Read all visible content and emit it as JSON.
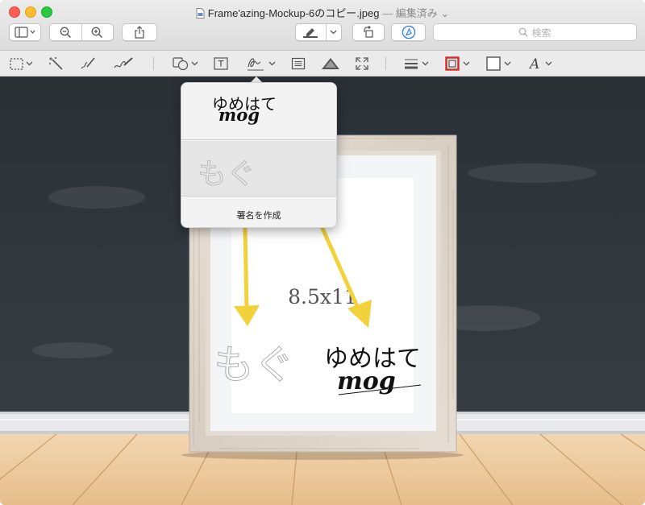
{
  "window": {
    "title": "Frame'azing-Mockup-6のコピー.jpeg",
    "title_status": "— 編集済み ⌄"
  },
  "toolbar": {
    "search_placeholder": "検索"
  },
  "signature_popover": {
    "signature1_line1": "ゆめはて",
    "signature1_line2": "mog",
    "signature2": "もぐ",
    "create_label": "署名を作成"
  },
  "image": {
    "frame_size_label": "8.5x11",
    "placed_sig_handwritten": "もぐ",
    "placed_sig_line1": "ゆめはて",
    "placed_sig_line2": "mog"
  },
  "colors": {
    "chalkboard": "#2c3338",
    "arrow": "#f2d23a",
    "accent": "#2f7df6"
  }
}
